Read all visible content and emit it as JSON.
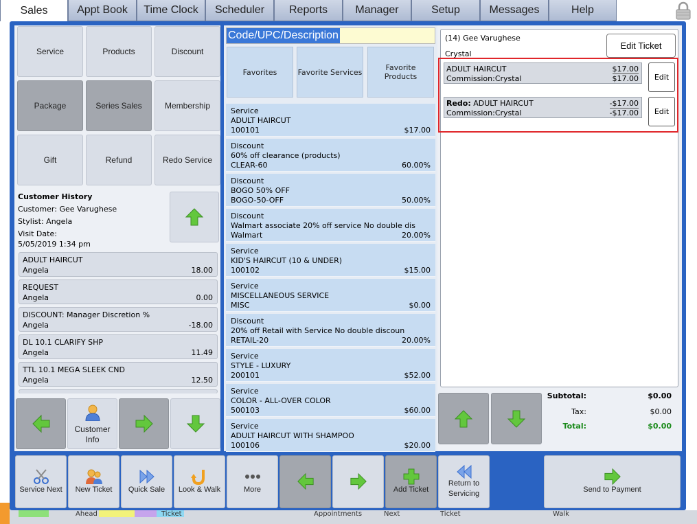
{
  "tabs": [
    "Sales",
    "Appt Book",
    "Time Clock",
    "Scheduler",
    "Reports",
    "Manager",
    "Setup",
    "Messages",
    "Help"
  ],
  "left_buttons": [
    "Service",
    "Products",
    "Discount",
    "Package",
    "Series Sales",
    "Membership",
    "Gift",
    "Refund",
    "Redo Service"
  ],
  "history": {
    "title": "Customer History",
    "customer": "Customer: Gee Varughese",
    "stylist": "Stylist: Angela",
    "visit_label": "Visit Date:",
    "visit_date": "5/05/2019 1:34 pm",
    "items": [
      {
        "name": "ADULT HAIRCUT",
        "stylist": "Angela",
        "amount": "18.00"
      },
      {
        "name": "REQUEST",
        "stylist": "Angela",
        "amount": "0.00"
      },
      {
        "name": "DISCOUNT: Manager Discretion %",
        "stylist": "Angela",
        "amount": "-18.00"
      },
      {
        "name": "DL 10.1 CLARIFY SHP",
        "stylist": "Angela",
        "amount": "11.49"
      },
      {
        "name": "TTL 10.1 MEGA SLEEK CND",
        "stylist": "Angela",
        "amount": "12.50"
      }
    ],
    "customer_info_label_1": "Customer",
    "customer_info_label_2": "Info"
  },
  "search": {
    "placeholder": "Code/UPC/Description"
  },
  "favorites": [
    "Favorites",
    "Favorite Services",
    "Favorite\nProducts"
  ],
  "items": [
    {
      "type": "Service",
      "name": "ADULT HAIRCUT",
      "code": "100101",
      "price": "$17.00"
    },
    {
      "type": "Discount",
      "name": "60% off clearance (products)",
      "code": "CLEAR-60",
      "price": "60.00%"
    },
    {
      "type": "Discount",
      "name": "BOGO 50% OFF",
      "code": "BOGO-50-OFF",
      "price": "50.00%"
    },
    {
      "type": "Discount",
      "name": "Walmart associate 20% off service No double dis",
      "code": "Walmart",
      "price": "20.00%"
    },
    {
      "type": "Service",
      "name": "KID'S HAIRCUT (10 & UNDER)",
      "code": "100102",
      "price": "$15.00"
    },
    {
      "type": "Service",
      "name": "MISCELLANEOUS SERVICE",
      "code": "MISC",
      "price": "$0.00"
    },
    {
      "type": "Discount",
      "name": "20% off Retail with Service No double discoun",
      "code": "RETAIL-20",
      "price": "20.00%"
    },
    {
      "type": "Service",
      "name": "STYLE - LUXURY",
      "code": "200101",
      "price": "$52.00"
    },
    {
      "type": "Service",
      "name": "COLOR - ALL-OVER COLOR",
      "code": "500103",
      "price": "$60.00"
    },
    {
      "type": "Service",
      "name": "ADULT HAIRCUT WITH SHAMPOO",
      "code": "100106",
      "price": "$20.00"
    }
  ],
  "ticket": {
    "header": "(14) Gee Varughese",
    "stylist": "Crystal",
    "edit_ticket": "Edit Ticket",
    "lines": [
      {
        "prefix": "",
        "name": "ADULT HAIRCUT",
        "price": "$17.00",
        "commission": "Commission:Crystal",
        "comm_price": "$17.00",
        "edit": "Edit"
      },
      {
        "prefix": "Redo:",
        "name": " ADULT HAIRCUT",
        "price": "-$17.00",
        "commission": "Commission:Crystal",
        "comm_price": "-$17.00",
        "edit": "Edit"
      }
    ]
  },
  "totals": {
    "subtotal_label": "Subtotal:",
    "subtotal": "$0.00",
    "tax_label": "Tax:",
    "tax": "$0.00",
    "total_label": "Total:",
    "total": "$0.00"
  },
  "bottom_buttons": [
    "Service Next",
    "New Ticket",
    "Quick Sale",
    "Look & Walk",
    "More",
    "",
    "",
    "Add Ticket",
    "Return to\nServicing",
    "Send to Payment"
  ],
  "under_labels": [
    "Ahead",
    "Ticket",
    "Appointments",
    "Next",
    "Ticket",
    "Walk"
  ],
  "colors": {
    "accent": "#2a63c2",
    "selection_border": "#e0262a",
    "total_green": "#1a8a1a"
  }
}
